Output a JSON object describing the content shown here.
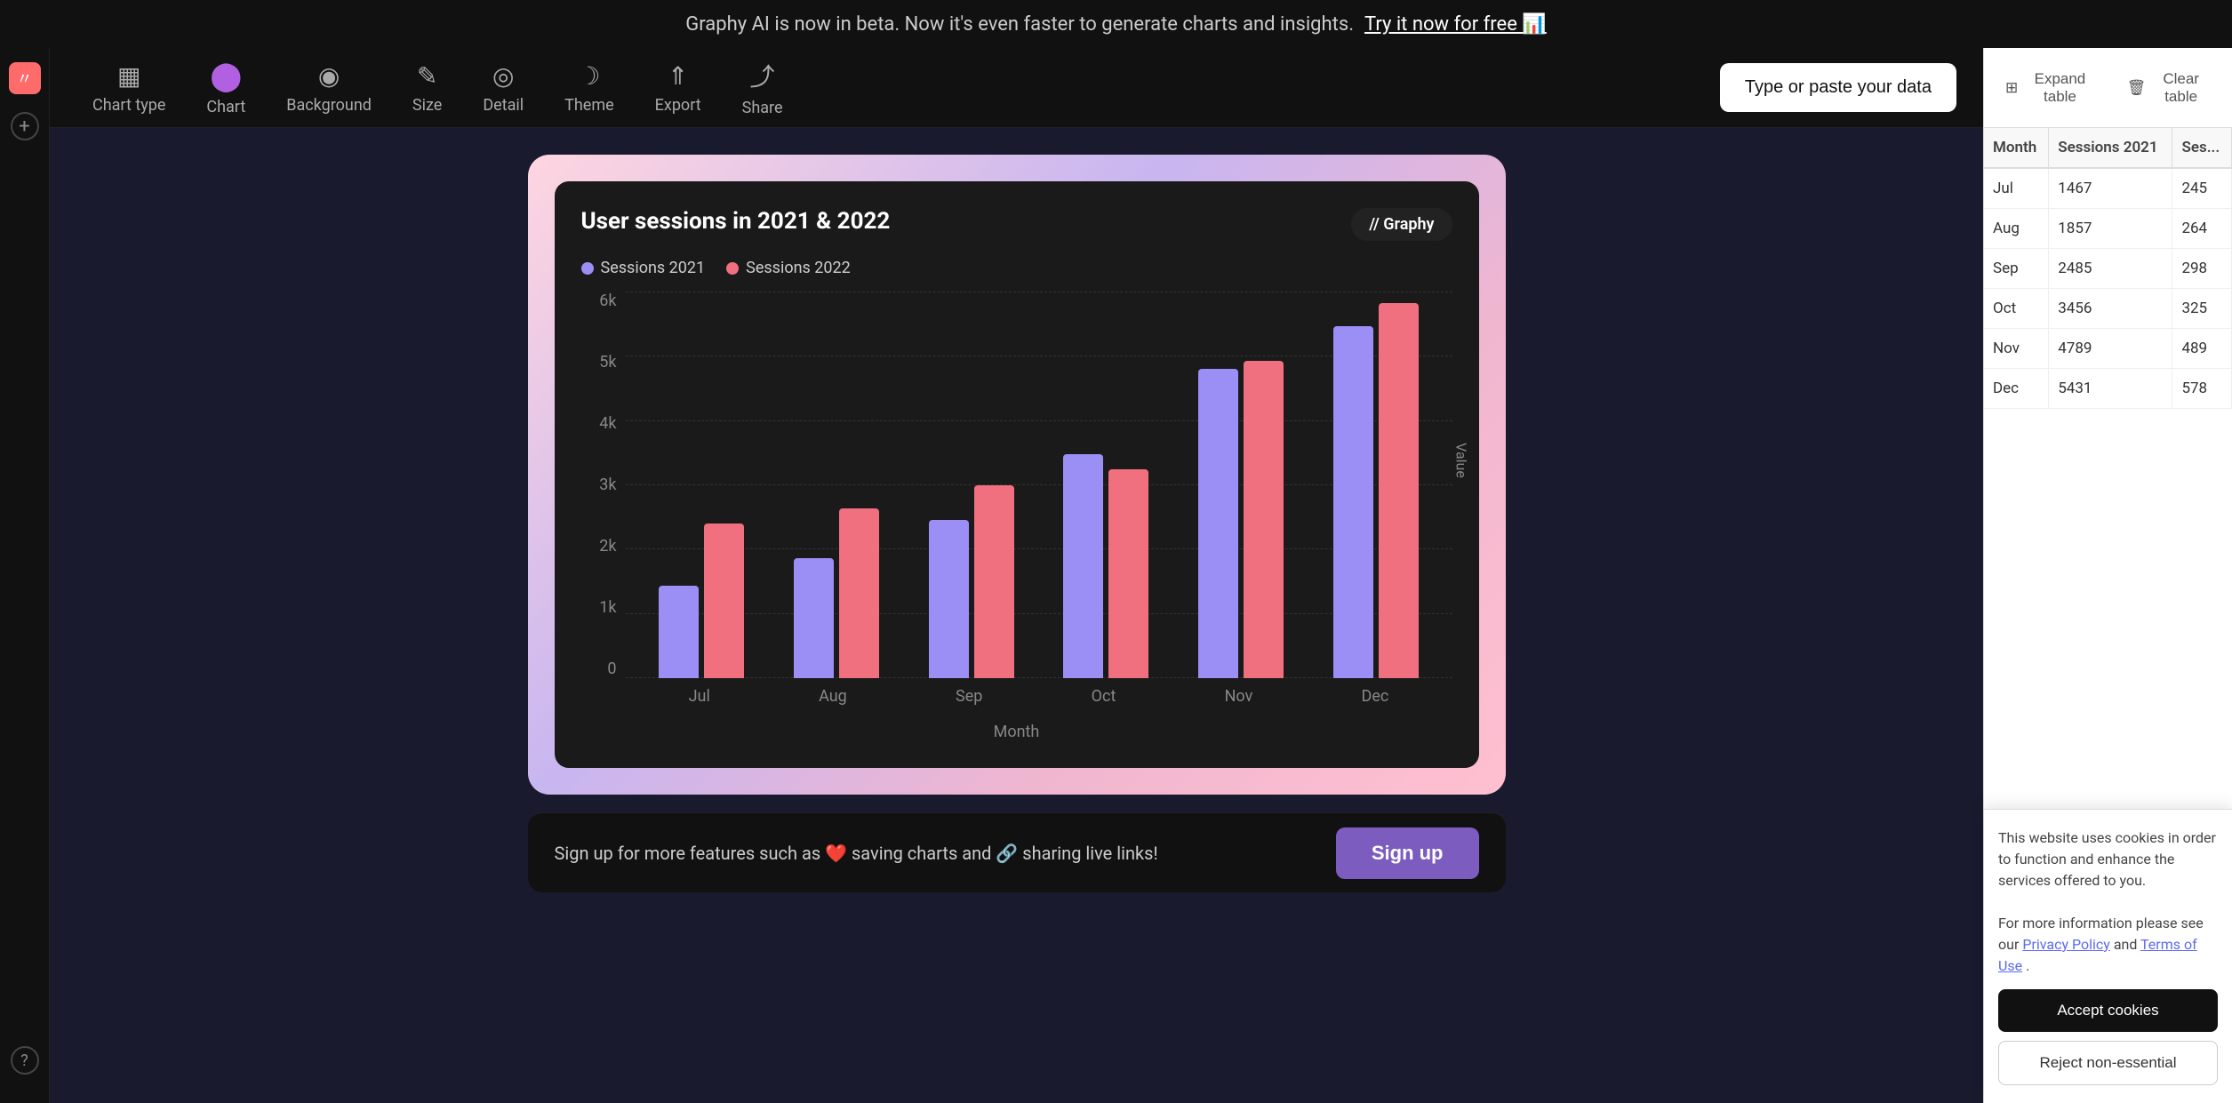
{
  "announcement": {
    "text": "Graphy AI is now in beta. Now it's even faster to generate charts and insights.",
    "cta_label": "Try it now for free 📊"
  },
  "toolbar": {
    "items": [
      {
        "id": "chart-type",
        "icon": "▦",
        "label": "Chart type"
      },
      {
        "id": "chart",
        "icon": "⬤",
        "label": "Chart"
      },
      {
        "id": "background",
        "icon": "◉",
        "label": "Background"
      },
      {
        "id": "size",
        "icon": "✎",
        "label": "Size"
      },
      {
        "id": "detail",
        "icon": "◎",
        "label": "Detail"
      },
      {
        "id": "theme",
        "icon": "☽",
        "label": "Theme"
      },
      {
        "id": "export",
        "icon": "⇑",
        "label": "Export"
      },
      {
        "id": "share",
        "icon": "⤴",
        "label": "Share"
      }
    ],
    "type_paste_label": "Type or paste your data"
  },
  "chart": {
    "title": "User sessions in 2021 & 2022",
    "logo": "// Graphy",
    "legend": [
      {
        "label": "Sessions 2021",
        "color": "blue"
      },
      {
        "label": "Sessions 2022",
        "color": "pink"
      }
    ],
    "x_axis_label": "Month",
    "y_axis_label": "Value",
    "y_axis_ticks": [
      "6k",
      "5k",
      "4k",
      "3k",
      "2k",
      "1k",
      "0"
    ],
    "bars": [
      {
        "month": "Jul",
        "v2021": 1467,
        "v2022": 2450,
        "h2021": 24,
        "h2022": 40
      },
      {
        "month": "Aug",
        "v2021": 1857,
        "v2022": 2640,
        "h2021": 31,
        "h2022": 44
      },
      {
        "month": "Sep",
        "v2021": 2485,
        "v2022": 2980,
        "h2021": 41,
        "h2022": 50
      },
      {
        "month": "Oct",
        "v2021": 3456,
        "v2022": 3250,
        "h2021": 58,
        "h2022": 54
      },
      {
        "month": "Nov",
        "v2021": 4789,
        "v2022": 4890,
        "h2021": 80,
        "h2022": 82
      },
      {
        "month": "Dec",
        "v2021": 5431,
        "v2022": 5780,
        "h2021": 91,
        "h2022": 97
      }
    ]
  },
  "right_panel": {
    "expand_table_label": "Expand table",
    "clear_table_label": "Clear table",
    "table_headers": [
      "Month",
      "Sessions 2021",
      "Ses..."
    ],
    "table_rows": [
      {
        "month": "Jul",
        "s2021": "1467",
        "s2022": "245"
      },
      {
        "month": "Aug",
        "s2021": "1857",
        "s2022": "264"
      },
      {
        "month": "Sep",
        "s2021": "2485",
        "s2022": "298"
      },
      {
        "month": "Oct",
        "s2021": "3456",
        "s2022": "325"
      },
      {
        "month": "Nov",
        "s2021": "4789",
        "s2022": "489"
      },
      {
        "month": "Dec",
        "s2021": "5431",
        "s2022": "578"
      }
    ]
  },
  "signup_bar": {
    "text": "Sign up for more features such as ❤️ saving charts and 🔗 sharing live links!",
    "button_label": "Sign up"
  },
  "cookie_banner": {
    "body_text": "This website uses cookies in order to function and enhance the services offered to you.",
    "policy_text": "For more information please see our",
    "privacy_policy_label": "Privacy Policy",
    "and_text": "and",
    "terms_label": "Terms of Use",
    "period": ".",
    "accept_label": "Accept cookies",
    "reject_label": "Reject non-essential"
  }
}
